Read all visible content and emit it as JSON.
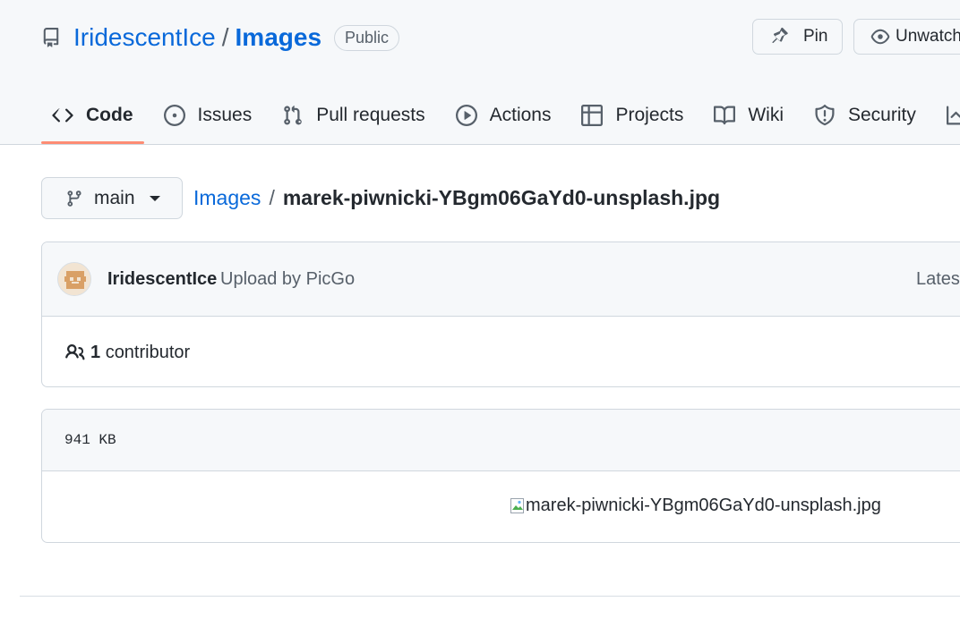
{
  "repo": {
    "owner": "IridescentIce",
    "separator": "/",
    "name": "Images",
    "visibility": "Public"
  },
  "header_buttons": {
    "pin_label": "Pin",
    "watch_label": "Unwatch"
  },
  "tabs": [
    {
      "label": "Code",
      "icon": "code-icon",
      "active": true
    },
    {
      "label": "Issues",
      "icon": "issue-opened-icon",
      "active": false
    },
    {
      "label": "Pull requests",
      "icon": "git-pull-request-icon",
      "active": false
    },
    {
      "label": "Actions",
      "icon": "play-icon",
      "active": false
    },
    {
      "label": "Projects",
      "icon": "table-icon",
      "active": false
    },
    {
      "label": "Wiki",
      "icon": "book-icon",
      "active": false
    },
    {
      "label": "Security",
      "icon": "shield-icon",
      "active": false
    }
  ],
  "branch": {
    "name": "main",
    "icon": "git-branch-icon"
  },
  "breadcrumb": {
    "repo_link": "Images",
    "separator": "/",
    "file": "marek-piwnicki-YBgm06GaYd0-unsplash.jpg"
  },
  "commit": {
    "author": "IridescentIce",
    "message": "Upload by PicGo",
    "latest_label": "Latest"
  },
  "contributors": {
    "count": "1",
    "label": "contributor",
    "icon": "people-icon"
  },
  "file": {
    "size": "941 KB",
    "image_alt": "marek-piwnicki-YBgm06GaYd0-unsplash.jpg"
  },
  "colors": {
    "link": "#0969da",
    "active_tab_underline": "#fd8c73",
    "header_bg": "#f6f8fa",
    "border": "#d0d7de"
  }
}
